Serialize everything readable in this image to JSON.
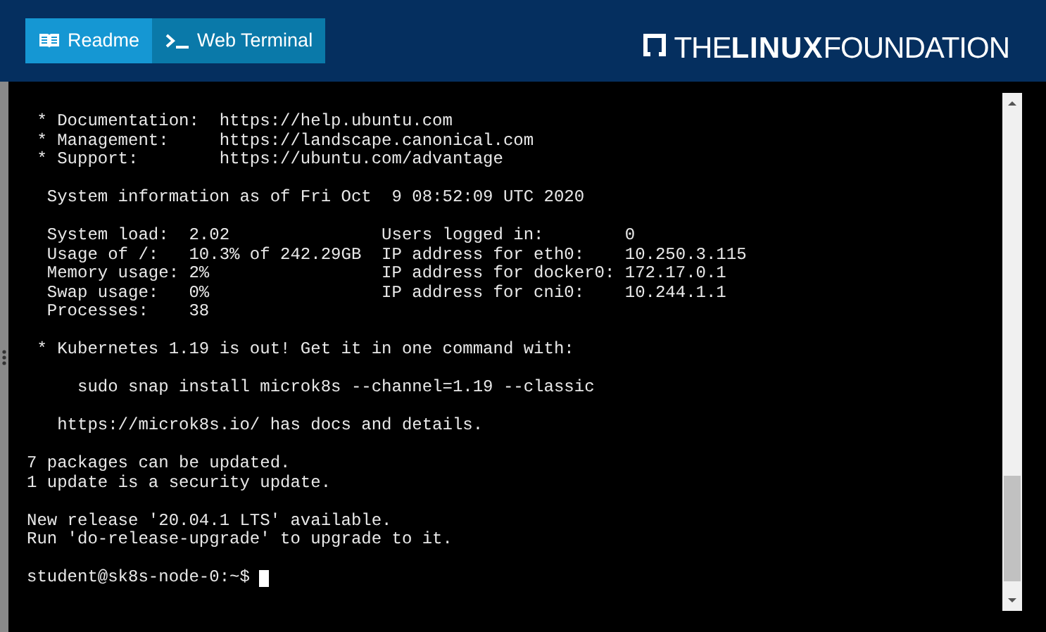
{
  "header": {
    "tabs": [
      {
        "label": "Readme",
        "kind": "readme",
        "selected": false
      },
      {
        "label": "Web Terminal",
        "kind": "terminal",
        "selected": true
      }
    ],
    "logo": "THE**LINUX**FOUNDATION"
  },
  "terminal": {
    "blocks": [
      {
        "lines": [
          " * Documentation:  https://help.ubuntu.com",
          " * Management:     https://landscape.canonical.com",
          " * Support:        https://ubuntu.com/advantage"
        ]
      },
      {
        "lines": [
          "  System information as of Fri Oct  9 08:52:09 UTC 2020"
        ]
      },
      {
        "lines": [
          "  System load:  2.02               Users logged in:        0",
          "  Usage of /:   10.3% of 242.29GB  IP address for eth0:    10.250.3.115",
          "  Memory usage: 2%                 IP address for docker0: 172.17.0.1",
          "  Swap usage:   0%                 IP address for cni0:    10.244.1.1",
          "  Processes:    38"
        ]
      },
      {
        "lines": [
          " * Kubernetes 1.19 is out! Get it in one command with:"
        ]
      },
      {
        "lines": [
          "     sudo snap install microk8s --channel=1.19 --classic"
        ]
      },
      {
        "lines": [
          "   https://microk8s.io/ has docs and details."
        ]
      },
      {
        "lines": [
          "7 packages can be updated.",
          "1 update is a security update."
        ]
      },
      {
        "lines": [
          "New release '20.04.1 LTS' available.",
          "Run 'do-release-upgrade' to upgrade to it."
        ]
      }
    ],
    "prompt": "student@sk8s-node-0:~$"
  }
}
